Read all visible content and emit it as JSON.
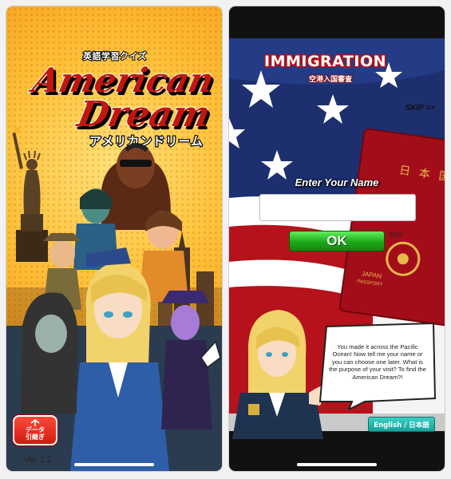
{
  "title_screen": {
    "subtitle_jp": "英語学習クイズ",
    "logo_line1": "American",
    "logo_line2": "Dream",
    "logo_katakana": "アメリカンドリーム",
    "data_button_line1": "データ",
    "data_button_line2": "引継ぎ",
    "version": "Ver 1.2"
  },
  "immigration_screen": {
    "title": "IMMIGRATION",
    "subtitle_jp": "空港入国審査",
    "skip_label": "SKIP >>",
    "enter_name_label": "Enter Your Name",
    "name_input_value": "",
    "ok_label": "OK",
    "char_counter": "0/15",
    "passport_text_1": "JAPAN",
    "passport_text_2": "PASSPORT",
    "speech_text": "You made it across the Pacific Ocean! Now tell me your name or you can choose one later. What is the purpose of your visit? To find the American Dream?!",
    "language_toggle": "English / 日本語"
  },
  "colors": {
    "logo_red": "#c0170e",
    "ok_green": "#1ea81a",
    "lang_teal": "#16a39a",
    "flag_red": "#b5121b",
    "flag_blue": "#1d2f6e",
    "passport_red": "#a30d1a"
  }
}
